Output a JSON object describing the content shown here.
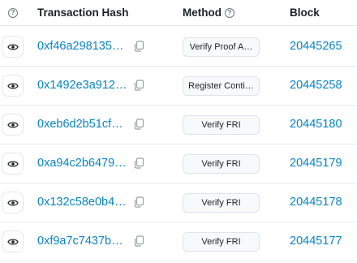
{
  "header": {
    "info_icon": "question-circle-icon",
    "info_glyph": "?",
    "col_hash": "Transaction Hash",
    "col_method": "Method",
    "col_block": "Block"
  },
  "rows": [
    {
      "hash": "0xf46a2981353…",
      "method": "Verify Proof A…",
      "block": "20445265"
    },
    {
      "hash": "0x1492e3a912…",
      "method": "Register Conti…",
      "block": "20445258"
    },
    {
      "hash": "0xeb6d2b51cfd…",
      "method": "Verify FRI",
      "block": "20445180"
    },
    {
      "hash": "0xa94c2b6479…",
      "method": "Verify FRI",
      "block": "20445179"
    },
    {
      "hash": "0x132c58e0b4…",
      "method": "Verify FRI",
      "block": "20445178"
    },
    {
      "hash": "0xf9a7c7437bc…",
      "method": "Verify FRI",
      "block": "20445177"
    }
  ],
  "colors": {
    "link": "#0784c3",
    "border": "#e7eaf3",
    "badge_bg": "#f8f9fa"
  },
  "icons": {
    "view": "eye-icon",
    "copy": "copy-icon"
  }
}
